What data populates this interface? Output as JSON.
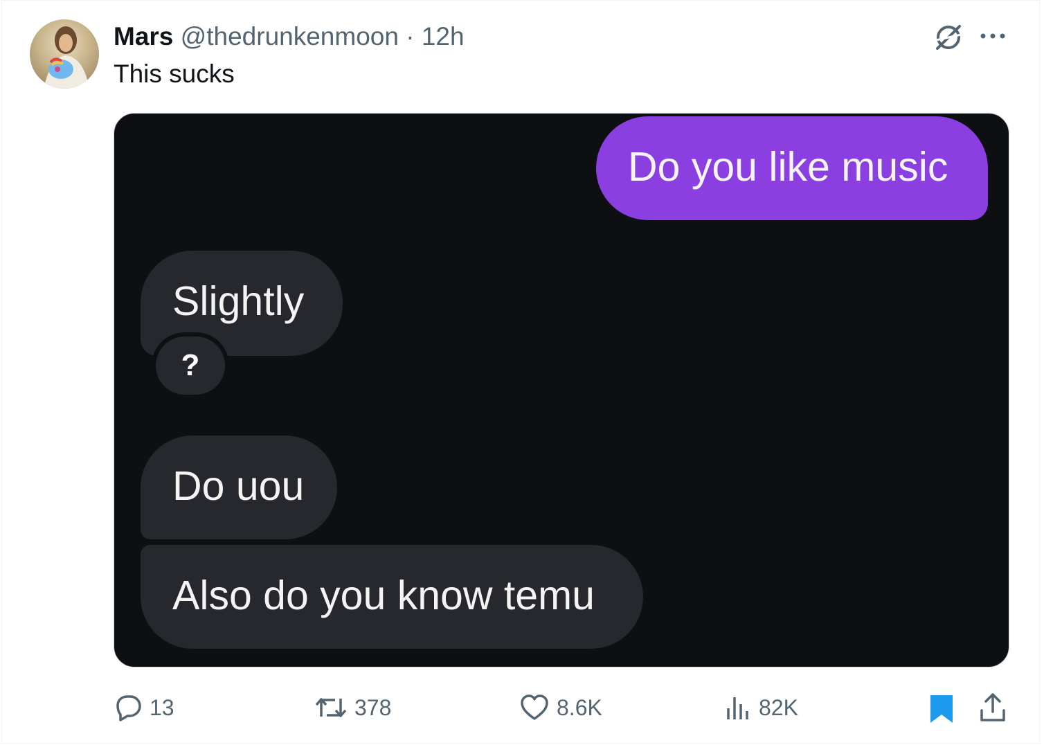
{
  "tweet": {
    "author_name": "Mars",
    "author_handle": "@thedrunkenmoon",
    "separator": "·",
    "time": "12h",
    "text": "This sucks"
  },
  "media": {
    "messages": [
      {
        "text": "Do you like music",
        "sender": "me"
      },
      {
        "text": "Slightly",
        "sender": "them"
      },
      {
        "text": "Do uou",
        "sender": "them"
      },
      {
        "text": "Also do you know temu",
        "sender": "them"
      }
    ],
    "reaction": "?"
  },
  "actions": {
    "replies": "13",
    "reposts": "378",
    "likes": "8.6K",
    "views": "82K"
  },
  "colors": {
    "accent": "#1d9bf0",
    "sent_bubble": "#8b3fe0",
    "received_bubble": "#26282d",
    "media_background": "#0d0f13",
    "muted": "#536471"
  },
  "icons": [
    "grok-icon",
    "more-icon",
    "reply-icon",
    "repost-icon",
    "like-icon",
    "views-icon",
    "bookmark-icon",
    "share-icon"
  ]
}
